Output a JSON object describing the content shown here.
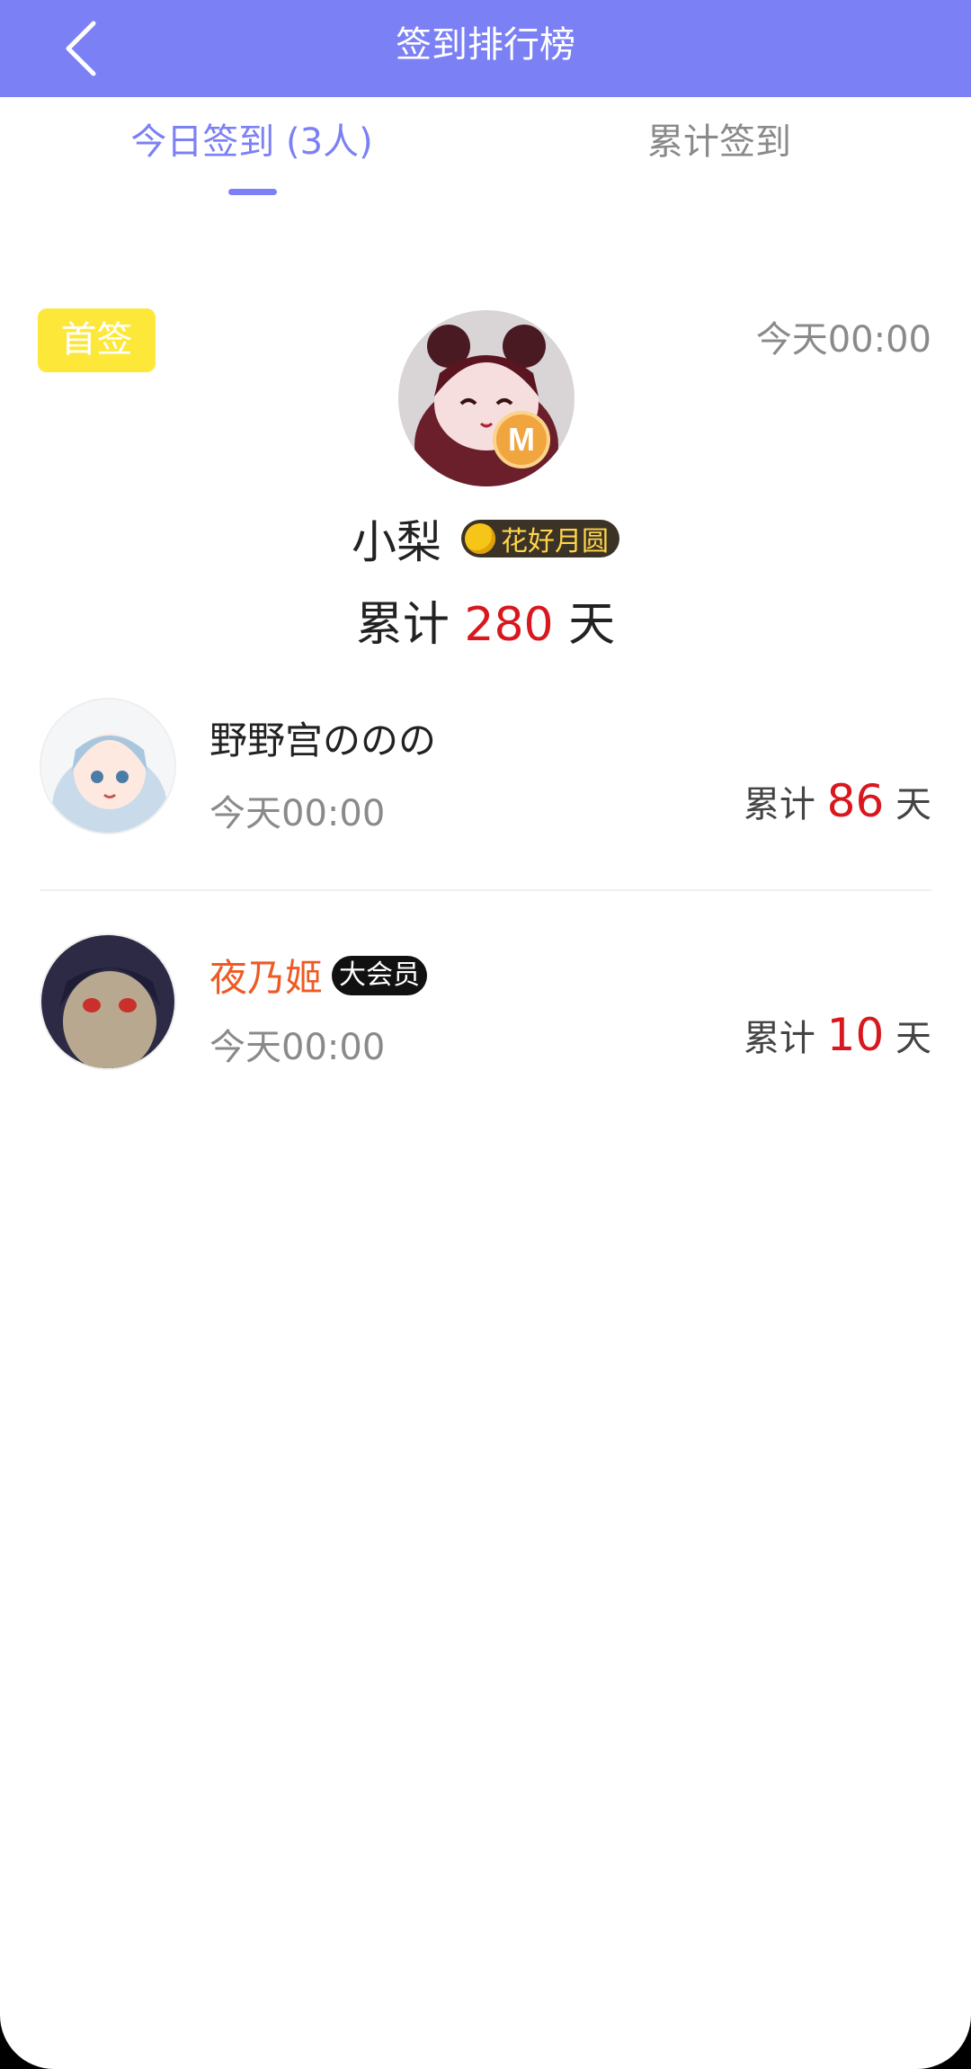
{
  "header": {
    "title": "签到排行榜",
    "back_icon": "chevron-left-icon"
  },
  "tabs": [
    {
      "label": "今日签到 (3人)",
      "active": true
    },
    {
      "label": "累计签到",
      "active": false
    }
  ],
  "colors": {
    "accent": "#7b80f5",
    "highlight": "#d8181e",
    "first_badge": "#fde83a"
  },
  "first": {
    "badge": "首签",
    "time": "今天00:00",
    "name": "小梨",
    "medal": "花好月圆",
    "coin_letter": "M",
    "total_prefix": "累计",
    "total_days": "280",
    "total_suffix": "天"
  },
  "list": [
    {
      "name": "野野宫ののの",
      "vip": "",
      "time": "今天00:00",
      "total_prefix": "累计",
      "total_days": "86",
      "total_suffix": "天"
    },
    {
      "name": "夜乃姬",
      "vip": "大会员",
      "time": "今天00:00",
      "total_prefix": "累计",
      "total_days": "10",
      "total_suffix": "天"
    }
  ]
}
